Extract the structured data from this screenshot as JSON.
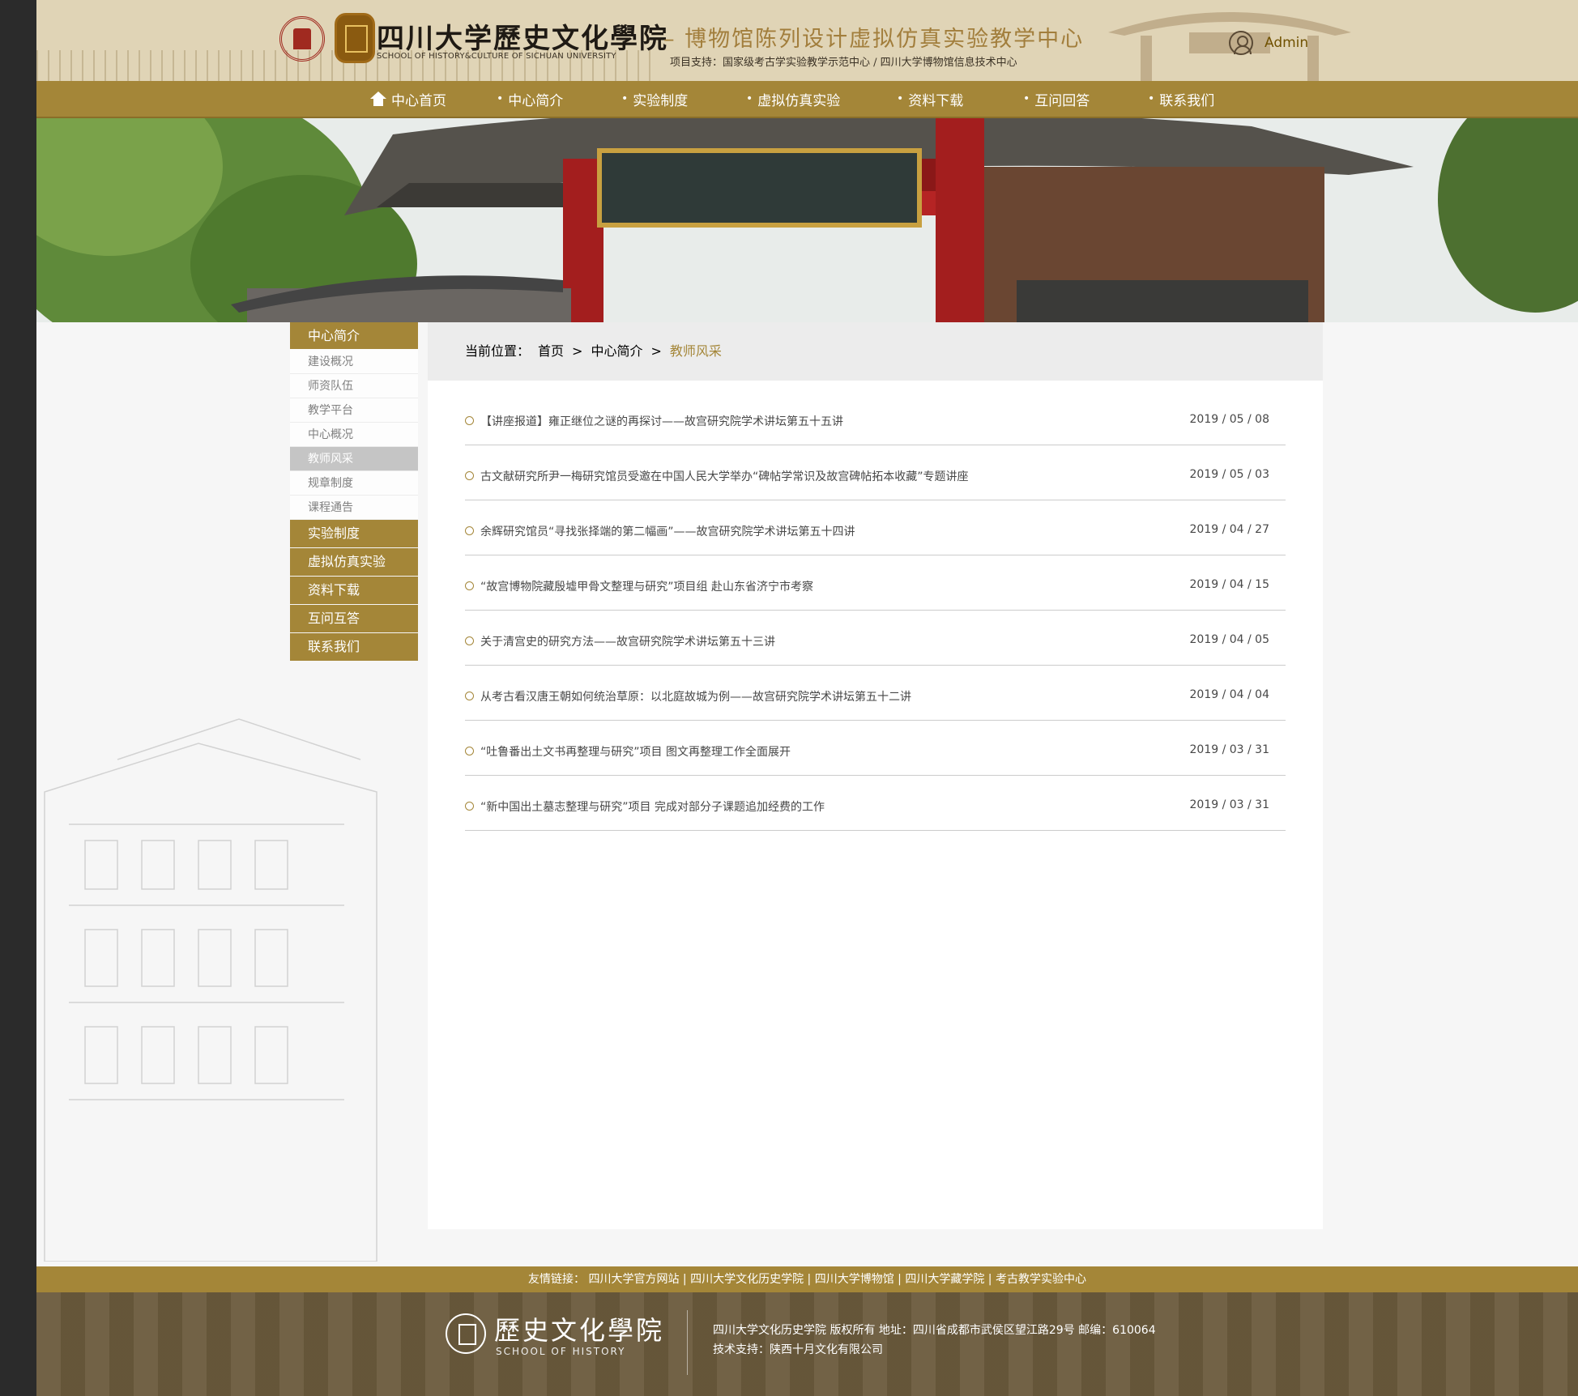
{
  "header": {
    "school_cn": "四川大学歷史文化學院",
    "school_en": "SCHOOL OF HISTORY&CULTURE OF SICHUAN UNIVERSITY",
    "center_title": "– 博物馆陈列设计虚拟仿真实验教学中心",
    "support": "项目支持：国家级考古学实验教学示范中心 / 四川大学博物馆信息技术中心",
    "user_name": "Admin"
  },
  "nav": {
    "items": [
      "中心首页",
      "中心简介",
      "实验制度",
      "虚拟仿真实验",
      "资料下载",
      "互问回答",
      "联系我们"
    ]
  },
  "sidebar": {
    "head": "中心简介",
    "sub_items": [
      "建设概况",
      "师资队伍",
      "教学平台",
      "中心概况",
      "教师风采",
      "规章制度",
      "课程通告"
    ],
    "categories": [
      "实验制度",
      "虚拟仿真实验",
      "资料下载",
      "互问互答",
      "联系我们"
    ]
  },
  "breadcrumb": {
    "prefix": "当前位置：",
    "home": "首页",
    "sep": ">",
    "parent": "中心简介",
    "current": "教师风采"
  },
  "news": [
    {
      "title": "【讲座报道】雍正继位之谜的再探讨——故宫研究院学术讲坛第五十五讲",
      "date": "2019 / 05 / 08"
    },
    {
      "title": "古文献研究所尹一梅研究馆员受邀在中国人民大学举办“碑帖学常识及故宫碑帖拓本收藏”专题讲座",
      "date": "2019 / 05 / 03"
    },
    {
      "title": "余辉研究馆员“寻找张择端的第二幅画”——故宫研究院学术讲坛第五十四讲",
      "date": "2019 / 04 / 27"
    },
    {
      "title": "“故宫博物院藏殷墟甲骨文整理与研究”项目组 赴山东省济宁市考察",
      "date": "2019 / 04 / 15"
    },
    {
      "title": "关于清宫史的研究方法——故宫研究院学术讲坛第五十三讲",
      "date": "2019 / 04 / 05"
    },
    {
      "title": "从考古看汉唐王朝如何统治草原：以北庭故城为例——故宫研究院学术讲坛第五十二讲",
      "date": "2019 / 04 / 04"
    },
    {
      "title": "“吐鲁番出土文书再整理与研究”项目 图文再整理工作全面展开",
      "date": "2019 / 03 / 31"
    },
    {
      "title": "“新中国出土墓志整理与研究”项目 完成对部分子课题追加经费的工作",
      "date": "2019 / 03 / 31"
    }
  ],
  "footer": {
    "links_label": "友情链接：",
    "links": [
      "四川大学官方网站",
      "四川大学文化历史学院",
      "四川大学博物馆",
      "四川大学藏学院",
      "考古教学实验中心"
    ],
    "link_sep": " | ",
    "logo_cn": "歷史文化學院",
    "logo_en": "SCHOOL OF HISTORY",
    "copyright": "四川大学文化历史学院 版权所有  地址：四川省成都市武侯区望江路29号 邮编：610064",
    "tech": "技术支持：陕西十月文化有限公司"
  },
  "colors": {
    "brand": "#a48638",
    "header_bg": "#e0d4b6",
    "user_text": "#705100",
    "crumb_bg": "#ececec",
    "active_item": "#c5c5c5",
    "divider": "#cccccc",
    "text": "#474747"
  }
}
